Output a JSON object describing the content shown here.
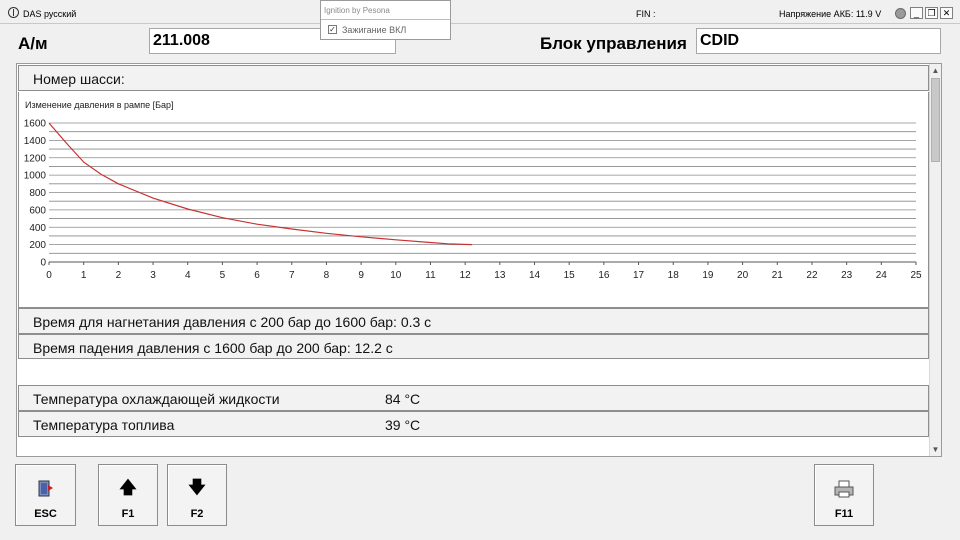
{
  "titlebar": {
    "app_title": "DAS русский",
    "fin_label": "FIN :",
    "voltage": "Напряжение АКБ: 11.9 V",
    "minimize": "_",
    "restore": "❐",
    "close": "✕"
  },
  "popup": {
    "title": "Ignition by Pesona",
    "check_mark": "✓",
    "option_label": "Зажигание ВКЛ"
  },
  "header": {
    "model_label": "А/м",
    "model_value": "211.008",
    "ecu_label": "Блок управления",
    "ecu_value": "CDID"
  },
  "panel": {
    "chassis_label": "Номер шасси:",
    "buildup_text": "Время для нагнетания давления с 200 бар до 1600 бар: 0.3 с",
    "drop_text": "Время падения давления с 1600 бар до 200 бар: 12.2 с",
    "coolant_label": "Температура охлаждающей жидкости",
    "coolant_value": "84 °C",
    "fuel_label": "Температура топлива",
    "fuel_value": "39 °C",
    "scroll_up": "▲",
    "scroll_down": "▼"
  },
  "chart_data": {
    "type": "line",
    "title": "Изменение давления в рампе [Бар]",
    "xlabel": "",
    "ylabel": "",
    "xlim": [
      0,
      25
    ],
    "ylim": [
      0,
      1600
    ],
    "x_ticks": [
      0,
      1,
      2,
      3,
      4,
      5,
      6,
      7,
      8,
      9,
      10,
      11,
      12,
      13,
      14,
      15,
      16,
      17,
      18,
      19,
      20,
      21,
      22,
      23,
      24,
      25
    ],
    "y_ticks": [
      0,
      200,
      400,
      600,
      800,
      1000,
      1200,
      1400,
      1600
    ],
    "grid": true,
    "line_color": "#c83232",
    "series": [
      {
        "x": [
          0,
          0.5,
          1,
          1.5,
          2,
          3,
          4,
          5,
          6,
          7,
          8,
          9,
          10,
          11,
          11.5,
          12.2
        ],
        "values": [
          1600,
          1370,
          1150,
          1010,
          900,
          735,
          610,
          510,
          435,
          380,
          330,
          290,
          255,
          225,
          210,
          200
        ]
      }
    ]
  },
  "buttons": {
    "esc": "ESC",
    "f1": "F1",
    "f2": "F2",
    "f11": "F11",
    "up_arrow": "🡅",
    "down_arrow": "🡇"
  }
}
